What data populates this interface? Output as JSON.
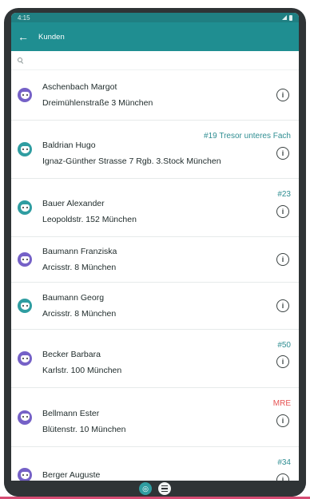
{
  "statusbar": {
    "time": "4:15",
    "icons": [
      "signal-icon",
      "battery-icon"
    ]
  },
  "appbar": {
    "title": "Kunden",
    "back_icon": "arrow-back-icon"
  },
  "search": {
    "icon": "search-icon",
    "value": "",
    "placeholder": ""
  },
  "customers": [
    {
      "name": "Aschenbach Margot",
      "address": "Dreimühlenstraße 3 München",
      "tag": "",
      "tag_color": "",
      "avatar": "purple"
    },
    {
      "name": "Baldrian Hugo",
      "address": "Ignaz-Günther Strasse 7 Rgb. 3.Stock München",
      "tag": "#19 Tresor unteres Fach",
      "tag_color": "teal",
      "avatar": "teal"
    },
    {
      "name": "Bauer Alexander",
      "address": "Leopoldstr. 152 München",
      "tag": "#23",
      "tag_color": "teal",
      "avatar": "teal"
    },
    {
      "name": "Baumann Franziska",
      "address": "Arcisstr. 8 München",
      "tag": "",
      "tag_color": "",
      "avatar": "purple"
    },
    {
      "name": "Baumann Georg",
      "address": "Arcisstr. 8 München",
      "tag": "",
      "tag_color": "",
      "avatar": "teal"
    },
    {
      "name": "Becker Barbara",
      "address": "Karlstr. 100 München",
      "tag": "#50",
      "tag_color": "teal",
      "avatar": "purple"
    },
    {
      "name": "Bellmann Ester",
      "address": "Blütenstr. 10 München",
      "tag": "MRE",
      "tag_color": "red",
      "avatar": "purple"
    },
    {
      "name": "Berger Auguste",
      "address": "",
      "tag": "#34",
      "tag_color": "teal",
      "avatar": "purple"
    }
  ],
  "bottombar": {
    "icons": [
      "globe-icon",
      "menu-icon"
    ]
  },
  "colors": {
    "primary": "#1f8e91",
    "accent_red": "#e65353",
    "avatar_purple": "#7561c7",
    "avatar_teal": "#2f9da1"
  }
}
